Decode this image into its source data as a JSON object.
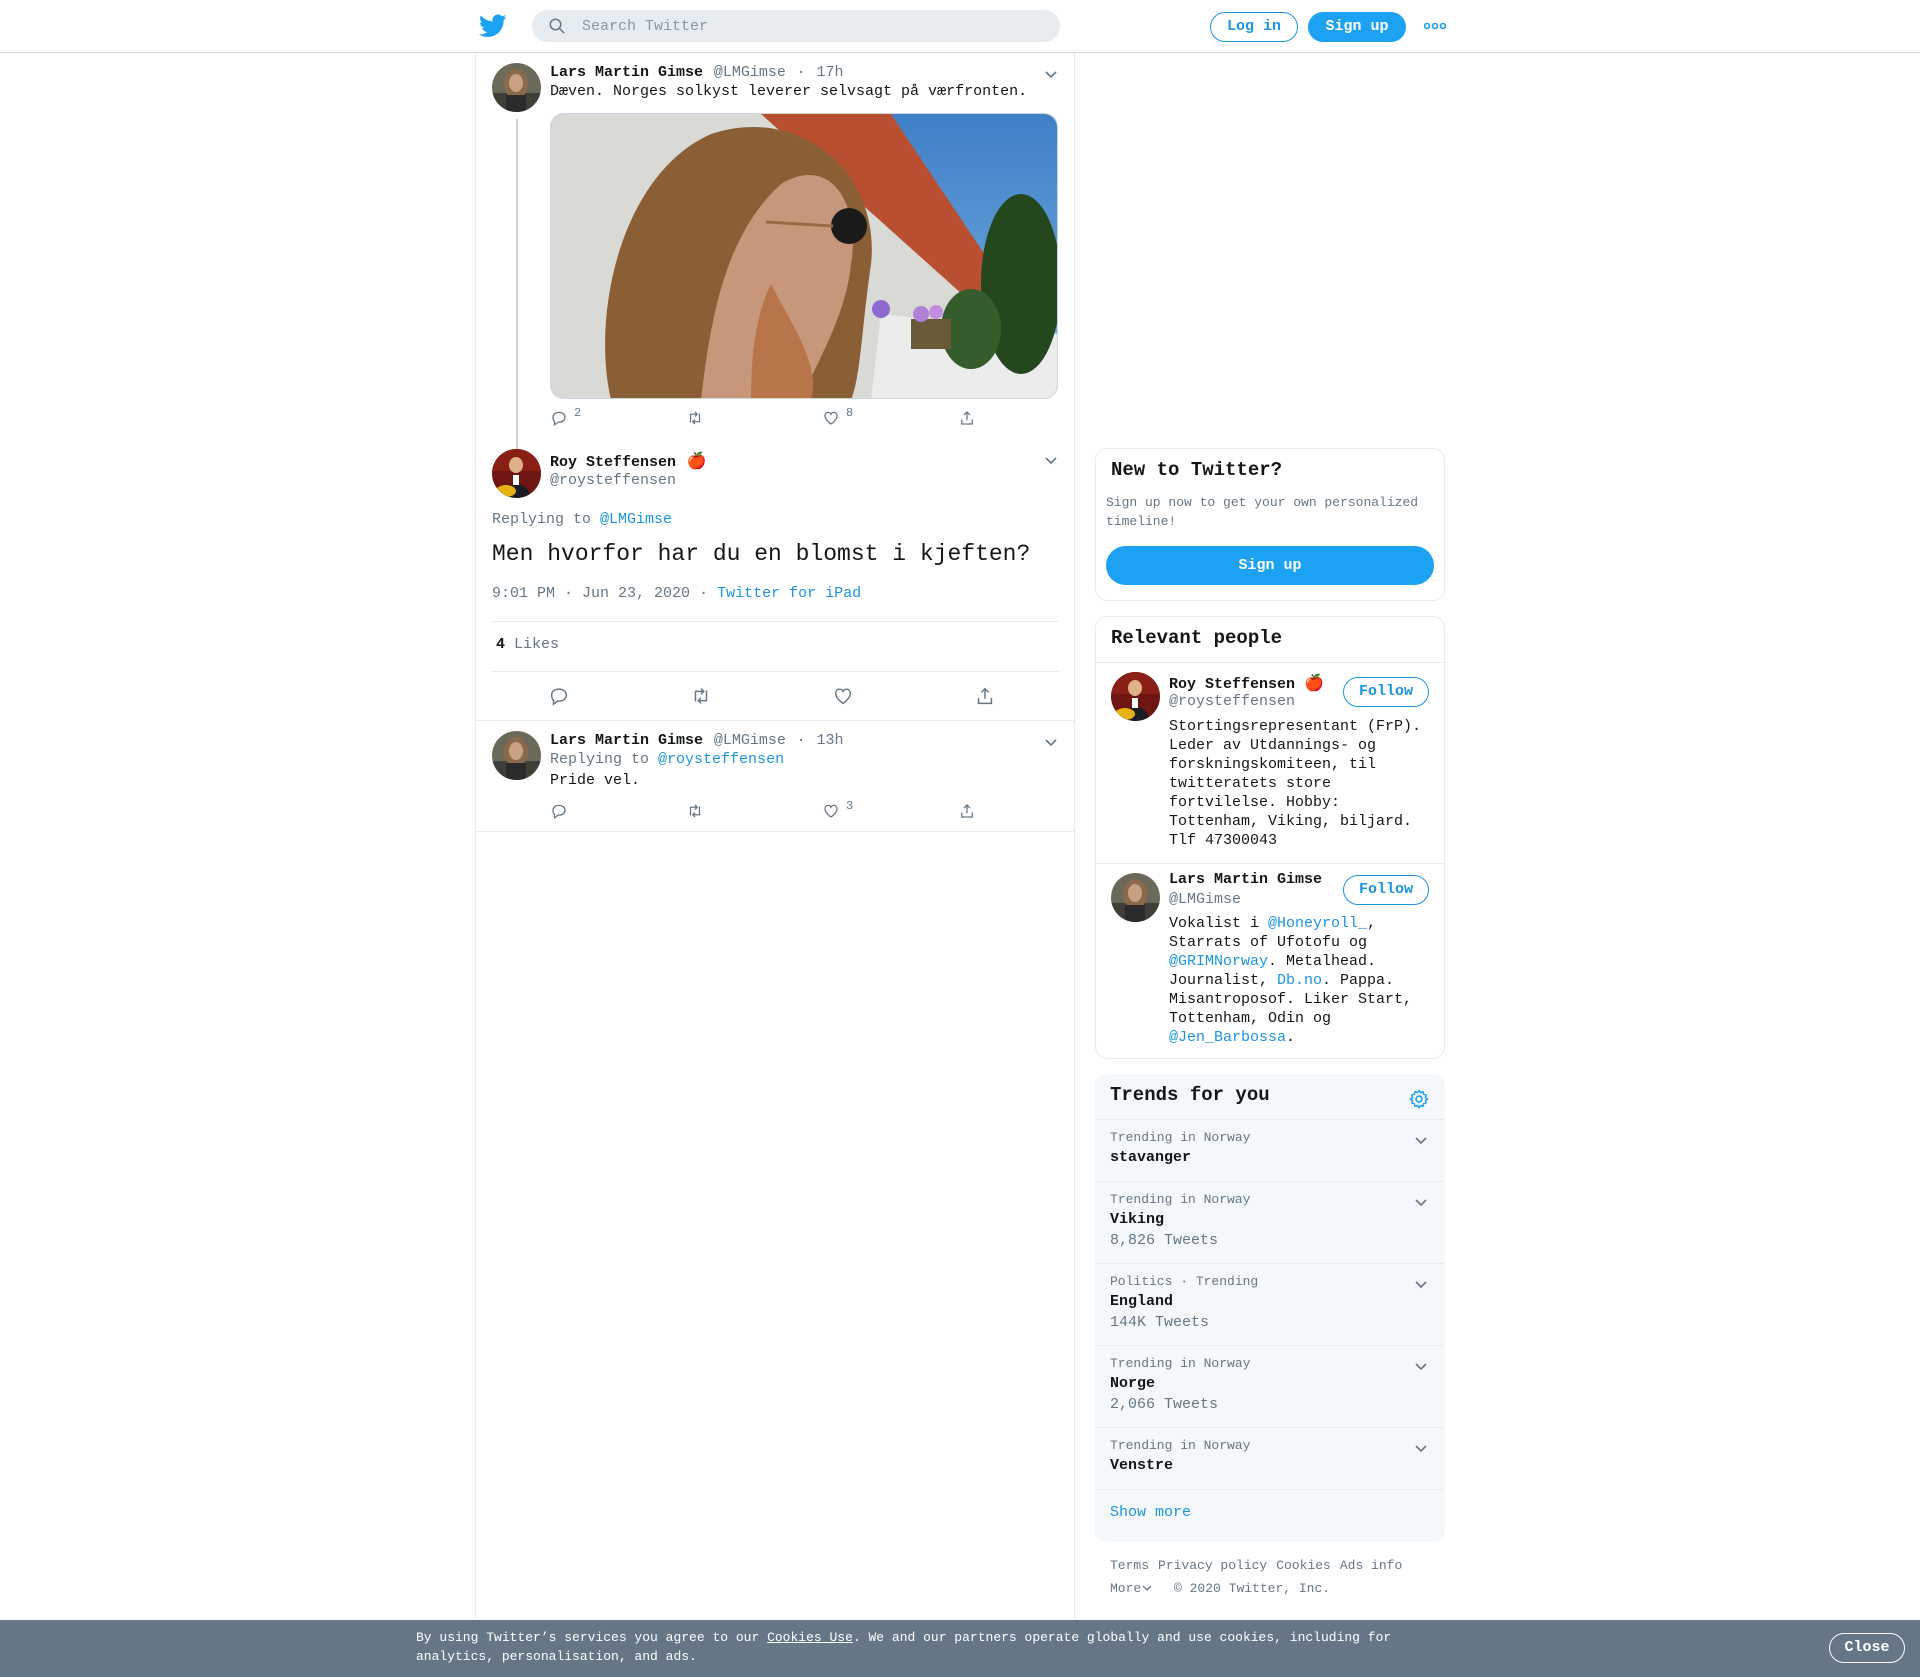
{
  "header": {
    "search_placeholder": "Search Twitter",
    "login_label": "Log in",
    "signup_label": "Sign up",
    "logo_icon": "twitter-bird-icon",
    "more_icon": "more-dots-icon"
  },
  "tweets": {
    "first": {
      "name": "Lars Martin Gimse",
      "handle": "@LMGimse",
      "sep": "·",
      "time": "17h",
      "text": "Dæven. Norges solkyst leverer selvsagt på værfronten.",
      "replies": "2",
      "likes": "8"
    },
    "main": {
      "name": "Roy Steffensen",
      "emoji": "🍎",
      "handle": "@roysteffensen",
      "replying_prefix": "Replying to",
      "replying_to": "@LMGimse",
      "text": "Men hvorfor har du en blomst i kjeften?",
      "time": "9:01 PM · Jun 23, 2020",
      "dot": "·",
      "source": "Twitter for iPad",
      "like_count": "4",
      "like_label": "Likes"
    },
    "reply": {
      "name": "Lars Martin Gimse",
      "handle": "@LMGimse",
      "sep": "·",
      "time": "13h",
      "replying_prefix": "Replying to",
      "replying_to": "@roysteffensen",
      "text": "Pride vel.",
      "likes": "3"
    }
  },
  "sidebar": {
    "new_to_twitter": {
      "title": "New to Twitter?",
      "desc": "Sign up now to get your own personalized timeline!",
      "button": "Sign up"
    },
    "relevant_people": {
      "title": "Relevant people",
      "people": [
        {
          "name": "Roy Steffensen",
          "emoji": "🍎",
          "handle": "@roysteffensen",
          "follow": "Follow",
          "bio": "Stortingsrepresentant (FrP). Leder av Utdannings- og forskningskomiteen, til twitteratets store fortvilelse. Hobby: Tottenham, Viking, biljard. Tlf 47300043"
        },
        {
          "name": "Lars Martin Gimse",
          "handle": "@LMGimse",
          "follow": "Follow",
          "bio_parts": [
            "Vokalist i ",
            "@Honeyroll_",
            ", Starrats of Ufotofu og ",
            "@GRIMNorway",
            ". Metalhead. Journalist, ",
            "Db.no",
            ". Pappa. Misantroposof. Liker Start, Tottenham, Odin og ",
            "@Jen_Barbossa",
            "."
          ]
        }
      ]
    },
    "trends": {
      "title": "Trends for you",
      "items": [
        {
          "context": "Trending in Norway",
          "name": "stavanger",
          "count": ""
        },
        {
          "context": "Trending in Norway",
          "name": "Viking",
          "count": "8,826 Tweets"
        },
        {
          "context": "Politics · Trending",
          "name": "England",
          "count": "144K Tweets"
        },
        {
          "context": "Trending in Norway",
          "name": "Norge",
          "count": "2,066 Tweets"
        },
        {
          "context": "Trending in Norway",
          "name": "Venstre",
          "count": ""
        }
      ],
      "show_more": "Show more"
    },
    "footer": {
      "links": [
        "Terms",
        "Privacy policy",
        "Cookies",
        "Ads info"
      ],
      "more": "More",
      "copyright": "© 2020 Twitter, Inc."
    }
  },
  "cookie_banner": {
    "text_before": "By using Twitter’s services you agree to our ",
    "link": "Cookies Use",
    "text_after": ". We and our partners operate globally and use cookies, including for analytics, personalisation, and ads.",
    "close": "Close"
  },
  "colors": {
    "accent": "#1da1f2",
    "link": "#1b95e0",
    "muted": "#657786",
    "banner": "#657786"
  }
}
